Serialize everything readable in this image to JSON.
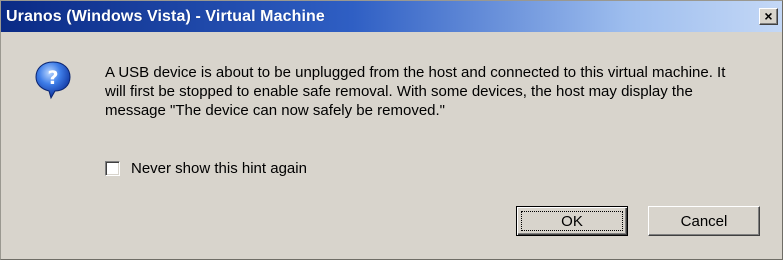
{
  "dialog": {
    "title": "Uranos (Windows Vista) - Virtual Machine",
    "close_label": "×",
    "icon": "question-icon",
    "message": "A USB device is about to be unplugged from the host and connected to this virtual machine. It will first be stopped to enable safe removal. With some devices, the host may display the message \"The device can now safely be removed.\"",
    "checkbox_label": "Never show this hint again",
    "checkbox_checked": false,
    "ok_label": "OK",
    "cancel_label": "Cancel"
  },
  "colors": {
    "titlebar_start": "#0a2a85",
    "titlebar_end": "#c4d8f6",
    "dialog_background": "#d8d4cc"
  }
}
